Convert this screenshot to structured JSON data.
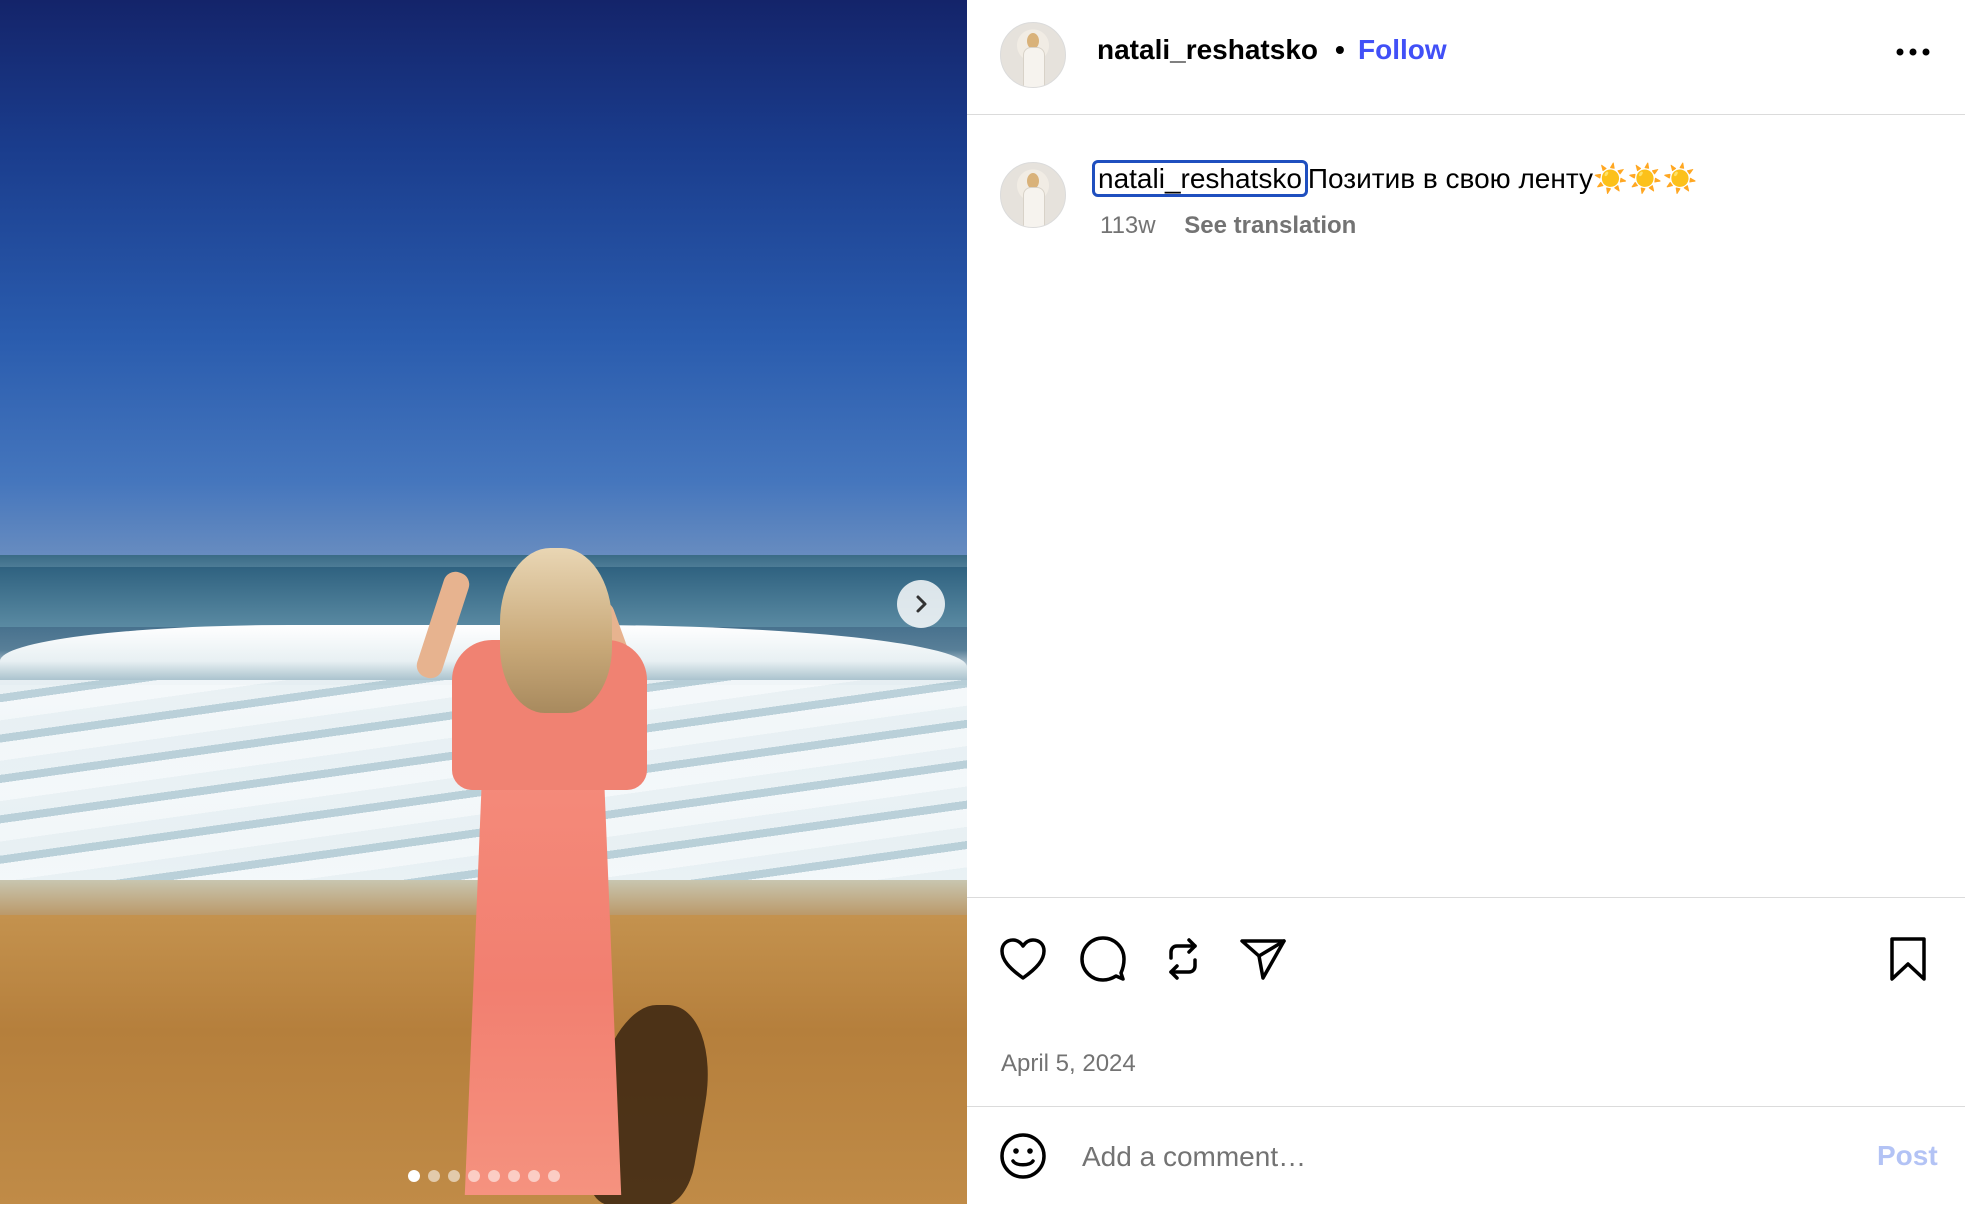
{
  "post": {
    "username": "natali_reshatsko",
    "separator": "•",
    "follow_label": "Follow",
    "more_icon": "more-horizontal-icon"
  },
  "caption": {
    "username": "natali_reshatsko",
    "text": "Позитив в свою ленту☀️☀️☀️",
    "age": "113w",
    "see_translation": "See translation"
  },
  "media": {
    "slide_count": 8,
    "active_slide": 1,
    "next_icon": "chevron-right-icon"
  },
  "actions": {
    "icons": [
      "heart-icon",
      "comment-icon",
      "repost-icon",
      "share-icon",
      "bookmark-icon"
    ],
    "date": "April 5, 2024"
  },
  "comment": {
    "placeholder": "Add a comment…",
    "post_label": "Post",
    "emoji_icon": "emoji-icon"
  },
  "colors": {
    "accent": "#4150f7",
    "post_disabled": "#b3c3f5",
    "secondary_text": "#737373",
    "divider": "#dbdbdb"
  }
}
